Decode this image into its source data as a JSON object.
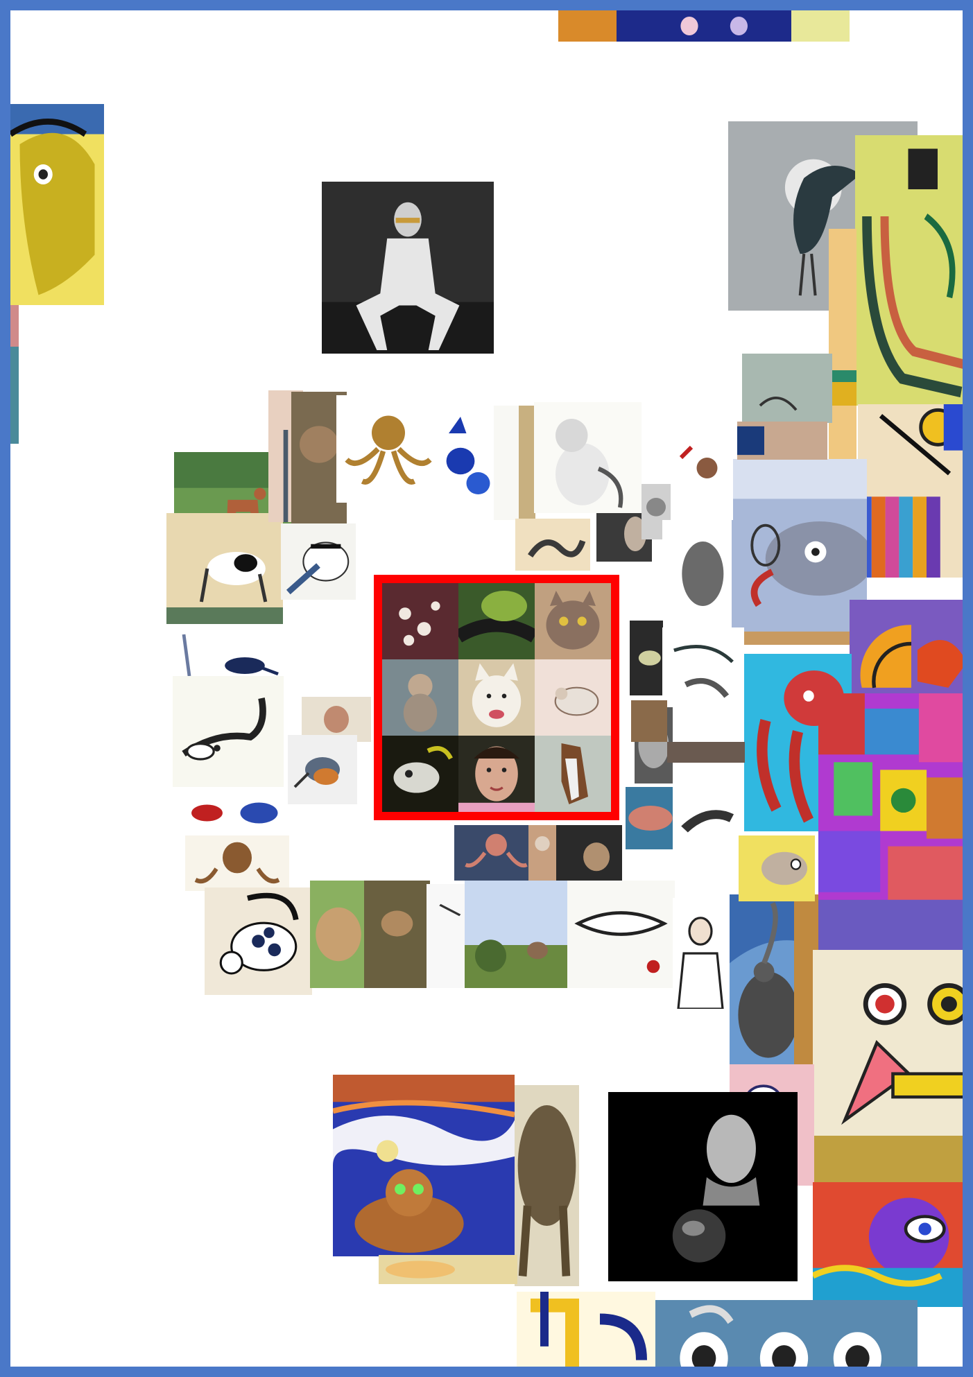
{
  "frame": {
    "border_color": "#4a78c8",
    "highlight_color": "#ff0000"
  },
  "collage": {
    "center_grid": [
      "octopus",
      "snake",
      "cat",
      "monkey",
      "dog",
      "bird",
      "fish",
      "woman",
      "horse"
    ],
    "tiles": [
      "abstract-horse-painting",
      "mannequin-photo",
      "heron-photo",
      "abstract-painting-yellow",
      "octopus-ink",
      "cat-ink",
      "dog-in-field",
      "bird-ink",
      "koi-ink",
      "cat-ink-spotted",
      "pointillist-sparrow",
      "cat-moon-painting",
      "bust-sculpture",
      "colorful-octopus",
      "abstract-collage",
      "abstract-face",
      "abstract-swirls-blue",
      "fish-surreal-painting"
    ]
  }
}
